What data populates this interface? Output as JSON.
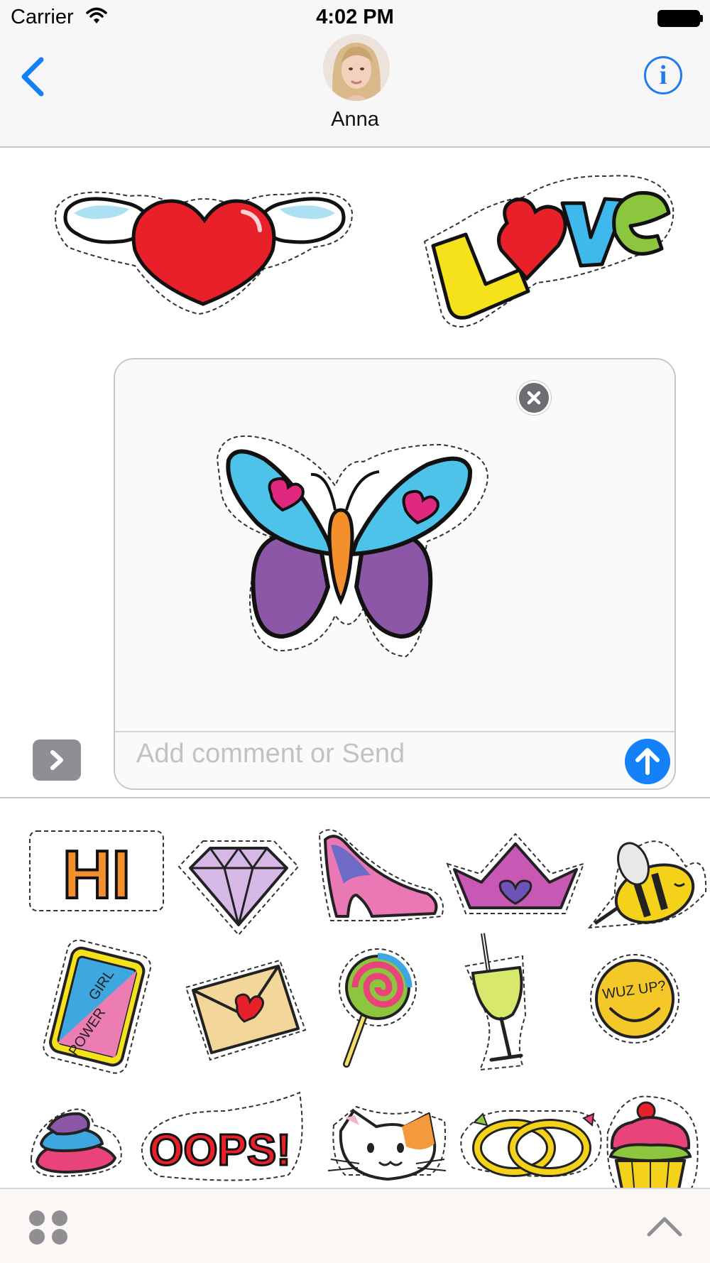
{
  "status_bar": {
    "carrier": "Carrier",
    "time": "4:02 PM"
  },
  "nav": {
    "contact_name": "Anna",
    "info_glyph": "i"
  },
  "compose": {
    "placeholder": "Add comment or Send"
  },
  "stickers": {
    "sent": [
      "heart-with-wings-sticker",
      "love-text-sticker"
    ],
    "selected": "butterfly-sticker",
    "grid": [
      "hi-sticker",
      "diamond-sticker",
      "high-heel-sticker",
      "crown-sticker",
      "bee-sticker",
      "girl-power-phone-sticker",
      "love-letter-sticker",
      "lollipop-sticker",
      "cocktail-sticker",
      "wuz-up-smiley-sticker",
      "swirl-sticker",
      "oops-sticker",
      "cat-sticker",
      "rings-sticker",
      "cupcake-sticker"
    ],
    "text": {
      "hi": "HI",
      "love_l": "L",
      "love_ve": "ve",
      "girl": "GIRL",
      "power": "POWER",
      "wuz_up": "WUZ UP?",
      "oops": "OOPS!"
    }
  },
  "colors": {
    "accent": "#1581f8",
    "gray_button": "#8e8e93"
  }
}
